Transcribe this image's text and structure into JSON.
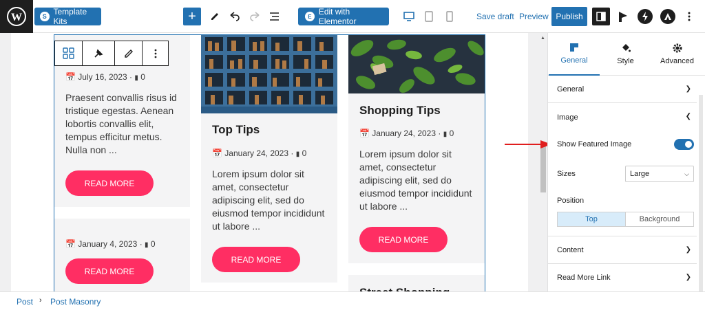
{
  "topbar": {
    "template_kits_label": "Template Kits",
    "edit_elementor_label": "Edit with Elementor",
    "save_draft_label": "Save draft",
    "preview_label": "Preview",
    "publish_label": "Publish"
  },
  "posts": {
    "card1": {
      "date": "July 16, 2023",
      "comments": "0",
      "excerpt": "Praesent convallis risus id tristique egestas. Aenean lobortis convallis elit, tempus efficitur metus. Nulla non ...",
      "read_more": "READ MORE"
    },
    "card2": {
      "date": "January 4, 2023",
      "comments": "0",
      "read_more": "READ MORE"
    },
    "card3": {
      "title": "Top Tips",
      "date": "January 24, 2023",
      "comments": "0",
      "excerpt": "Lorem ipsum dolor sit amet, consectetur adipiscing elit, sed do eiusmod tempor incididunt ut labore ...",
      "read_more": "READ MORE"
    },
    "card4": {
      "title": "Shopping Tips",
      "date": "January 24, 2023",
      "comments": "0",
      "excerpt": "Lorem ipsum dolor sit amet, consectetur adipiscing elit, sed do eiusmod tempor incididunt ut labore ...",
      "read_more": "READ MORE"
    },
    "card5": {
      "title": "Street Shopping"
    }
  },
  "panel": {
    "tabs": {
      "general": "General",
      "style": "Style",
      "advanced": "Advanced"
    },
    "sections": {
      "general": "General",
      "image": "Image",
      "content": "Content",
      "read_more_link": "Read More Link"
    },
    "image": {
      "show_featured_label": "Show Featured Image",
      "show_featured_on": true,
      "sizes_label": "Sizes",
      "sizes_value": "Large",
      "position_label": "Position",
      "position_options": [
        "Top",
        "Background"
      ],
      "position_selected": "Top"
    }
  },
  "breadcrumb": {
    "item1": "Post",
    "item2": "Post Masonry"
  },
  "colors": {
    "accent": "#2271b1",
    "button": "#ff2e63",
    "arrow": "#e01e1e"
  }
}
